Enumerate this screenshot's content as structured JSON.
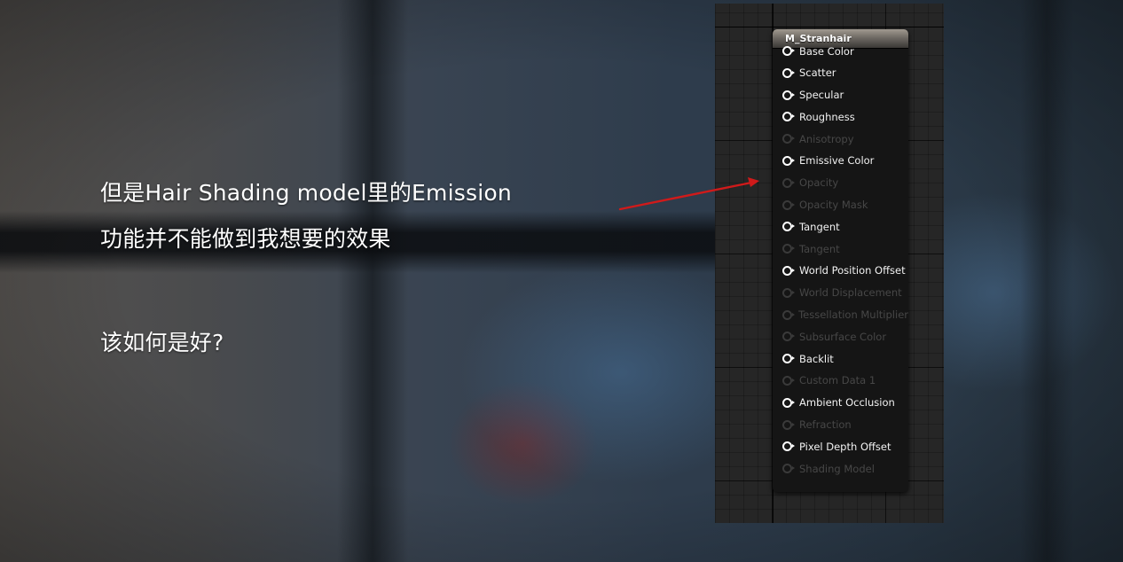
{
  "slide": {
    "caption_line1": "但是Hair Shading model里的Emission",
    "caption_line2": "功能并不能做到我想要的效果",
    "caption_line3": "该如何是好?"
  },
  "colors": {
    "arrow": "#d01a1a",
    "pin_enabled": "#ffffff",
    "pin_disabled": "#3a3a3a",
    "node_header": "#8a847c"
  },
  "material_node": {
    "title": "M_Stranhair",
    "pins": [
      {
        "label": "Base Color",
        "enabled": true
      },
      {
        "label": "Scatter",
        "enabled": true
      },
      {
        "label": "Specular",
        "enabled": true
      },
      {
        "label": "Roughness",
        "enabled": true
      },
      {
        "label": "Anisotropy",
        "enabled": false
      },
      {
        "label": "Emissive Color",
        "enabled": true
      },
      {
        "label": "Opacity",
        "enabled": false
      },
      {
        "label": "Opacity Mask",
        "enabled": false
      },
      {
        "label": "Tangent",
        "enabled": true
      },
      {
        "label": "Tangent",
        "enabled": false
      },
      {
        "label": "World Position Offset",
        "enabled": true
      },
      {
        "label": "World Displacement",
        "enabled": false
      },
      {
        "label": "Tessellation Multiplier",
        "enabled": false
      },
      {
        "label": "Subsurface Color",
        "enabled": false
      },
      {
        "label": "Backlit",
        "enabled": true
      },
      {
        "label": "Custom Data 1",
        "enabled": false
      },
      {
        "label": "Ambient Occlusion",
        "enabled": true
      },
      {
        "label": "Refraction",
        "enabled": false
      },
      {
        "label": "Pixel Depth Offset",
        "enabled": true
      },
      {
        "label": "Shading Model",
        "enabled": false
      }
    ]
  }
}
